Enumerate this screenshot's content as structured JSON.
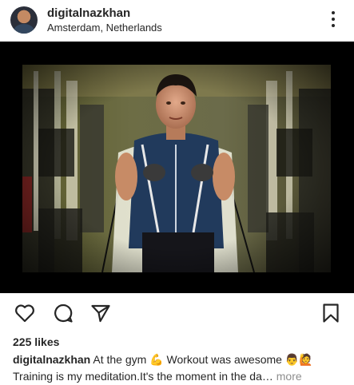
{
  "header": {
    "username": "digitalnazkhan",
    "location": "Amsterdam, Netherlands",
    "avatar_icon": "profile-avatar",
    "more_icon": "vertical-ellipsis-icon"
  },
  "post": {
    "image_alt": ""
  },
  "actions": {
    "like_icon": "heart-icon",
    "comment_icon": "comment-bubble-icon",
    "share_icon": "paper-plane-icon",
    "save_icon": "bookmark-icon"
  },
  "likes": {
    "text": "225 likes"
  },
  "caption": {
    "username": "digitalnazkhan",
    "line1": "At the gym 💪 Workout was awesome 👨🙋",
    "line2": "Training is my meditation.It's the moment in the da…",
    "more_label": "more"
  },
  "colors": {
    "text": "#262626",
    "muted": "#8e8e8e",
    "image_frame": "#000000"
  }
}
